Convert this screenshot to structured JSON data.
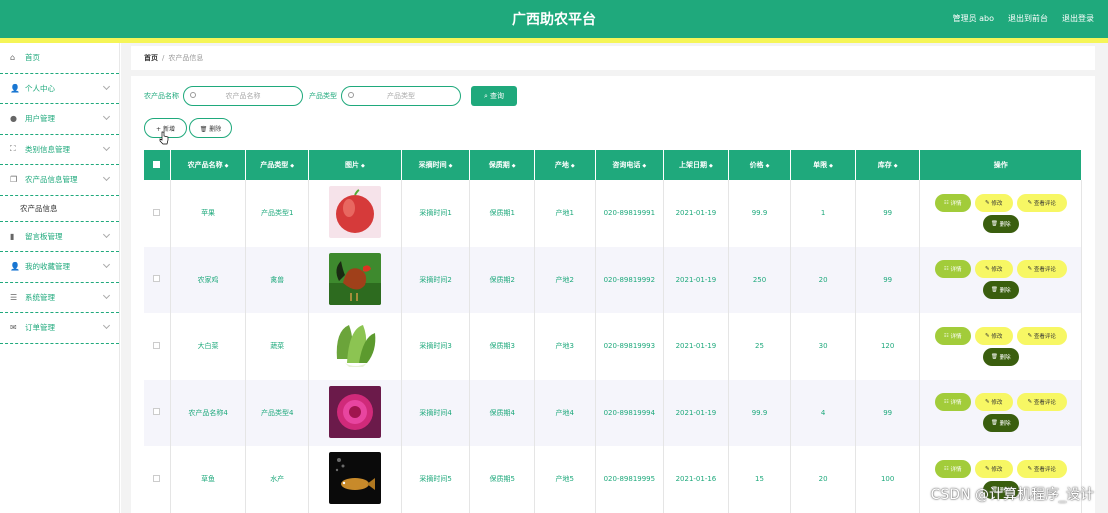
{
  "header": {
    "title": "广西助农平台",
    "admin": "管理员 abo",
    "back_to_front": "退出到前台",
    "logout": "退出登录"
  },
  "sidebar": {
    "items": [
      {
        "label": "首页",
        "icon": "home-icon",
        "glyph": "⌂"
      },
      {
        "label": "个人中心",
        "icon": "user-icon",
        "glyph": "👤"
      },
      {
        "label": "用户管理",
        "icon": "pin-icon",
        "glyph": "●"
      },
      {
        "label": "类别信息管理",
        "icon": "expand-icon",
        "glyph": "⛶"
      },
      {
        "label": "农产品信息管理",
        "icon": "copy-icon",
        "glyph": "❐"
      },
      {
        "label": "留言板管理",
        "icon": "chart-icon",
        "glyph": "▮"
      },
      {
        "label": "我的收藏管理",
        "icon": "user-icon",
        "glyph": "👤"
      },
      {
        "label": "系统管理",
        "icon": "sliders-icon",
        "glyph": "☰"
      },
      {
        "label": "订单管理",
        "icon": "mail-icon",
        "glyph": "✉"
      }
    ],
    "sub_item": "农产品信息"
  },
  "breadcrumb": {
    "home": "首页",
    "sep": "/",
    "current": "农产品信息"
  },
  "search": {
    "name_label": "农产品名称",
    "name_placeholder": "农产品名称",
    "type_label": "产品类型",
    "type_placeholder": "产品类型",
    "button": "查询"
  },
  "actions": {
    "add": "+ 新增",
    "delete": "🗑 删除"
  },
  "table": {
    "headers": [
      "农产品名称",
      "产品类型",
      "图片",
      "采摘时间",
      "保质期",
      "产地",
      "咨询电话",
      "上架日期",
      "价格",
      "单限",
      "库存",
      "操作"
    ],
    "rows": [
      {
        "name": "苹果",
        "type": "产品类型1",
        "pick": "采摘时间1",
        "shelf": "保质期1",
        "origin": "产地1",
        "phone": "020-89819991",
        "date": "2021-01-19",
        "price": "99.9",
        "limit": "1",
        "stock": "99",
        "img": "apple"
      },
      {
        "name": "农家鸡",
        "type": "禽兽",
        "pick": "采摘时间2",
        "shelf": "保质期2",
        "origin": "产地2",
        "phone": "020-89819992",
        "date": "2021-01-19",
        "price": "250",
        "limit": "20",
        "stock": "99",
        "img": "rooster"
      },
      {
        "name": "大白菜",
        "type": "蔬菜",
        "pick": "采摘时间3",
        "shelf": "保质期3",
        "origin": "产地3",
        "phone": "020-89819993",
        "date": "2021-01-19",
        "price": "25",
        "limit": "30",
        "stock": "120",
        "img": "cabbage"
      },
      {
        "name": "农产品名称4",
        "type": "产品类型4",
        "pick": "采摘时间4",
        "shelf": "保质期4",
        "origin": "产地4",
        "phone": "020-89819994",
        "date": "2021-01-19",
        "price": "99.9",
        "limit": "4",
        "stock": "99",
        "img": "flower"
      },
      {
        "name": "草鱼",
        "type": "水产",
        "pick": "采摘时间5",
        "shelf": "保质期5",
        "origin": "产地5",
        "phone": "020-89819995",
        "date": "2021-01-16",
        "price": "15",
        "limit": "20",
        "stock": "100",
        "img": "fish"
      }
    ],
    "ops": {
      "detail": "详情",
      "edit": "修改",
      "review": "查看评论",
      "del": "删除"
    }
  },
  "watermark": "CSDN @计算机程序_设计",
  "colors": {
    "primary": "#1fa97c",
    "accent_yellow": "#f5f557",
    "dark_green": "#3a5e0e"
  }
}
